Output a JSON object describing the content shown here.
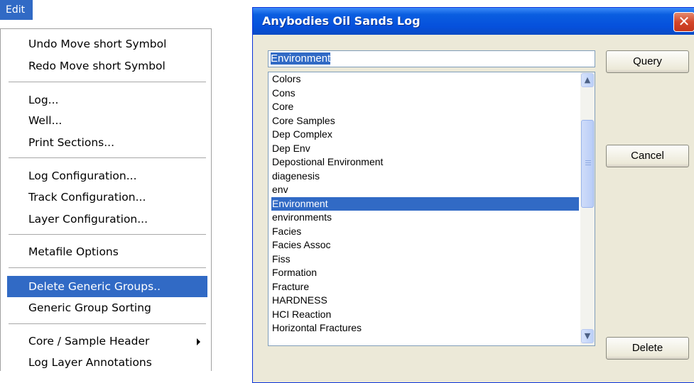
{
  "menu": {
    "title": "Edit",
    "items": [
      {
        "label": "Undo Move short Symbol"
      },
      {
        "label": "Redo Move short Symbol"
      },
      {
        "label": "Log..."
      },
      {
        "label": "Well..."
      },
      {
        "label": "Print Sections..."
      },
      {
        "label": "Log Configuration..."
      },
      {
        "label": "Track Configuration..."
      },
      {
        "label": "Layer Configuration..."
      },
      {
        "label": "Metafile Options"
      },
      {
        "label": "Delete Generic Groups.."
      },
      {
        "label": "Generic Group Sorting"
      },
      {
        "label": "Core / Sample Header"
      },
      {
        "label": "Log Layer Annotations"
      }
    ],
    "selected_item": "Delete Generic Groups..",
    "submenu_item": "Core / Sample Header"
  },
  "dialog": {
    "title": "Anybodies Oil Sands Log",
    "query_value": "Environment",
    "buttons": {
      "query": "Query",
      "cancel": "Cancel",
      "delete": "Delete"
    },
    "list": [
      "Colors",
      "Cons",
      "Core",
      "Core Samples",
      "Dep Complex",
      "Dep Env",
      "Depostional Environment",
      "diagenesis",
      "env",
      "Environment",
      "environments",
      "Facies",
      "Facies Assoc",
      "Fiss",
      "Formation",
      "Fracture",
      "HARDNESS",
      "HCI Reaction",
      "Horizontal Fractures"
    ],
    "selected_list_item": "Environment",
    "scroll_icons": {
      "up": "scroll-up-arrow-icon",
      "down": "scroll-down-arrow-icon"
    },
    "colors": {
      "selection": "#316ac5",
      "titlebar": "#0550dc",
      "face": "#ece9d8"
    }
  }
}
